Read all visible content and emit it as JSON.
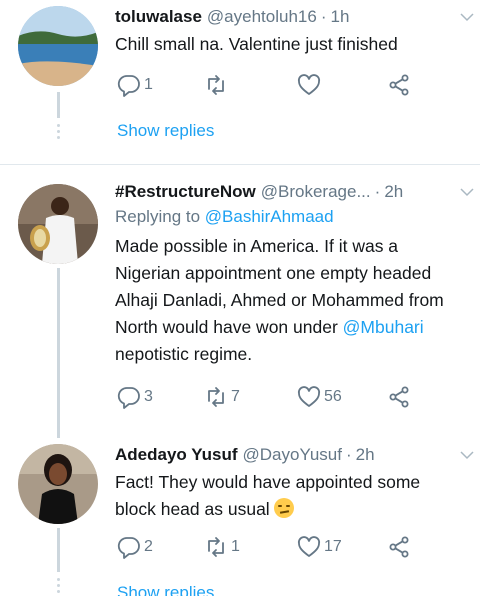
{
  "tweets": [
    {
      "name": "toluwalase",
      "handle": "@ayehtoluh16",
      "time": "1h",
      "reply_to_label": "",
      "reply_to_user": "",
      "text": "Chill small na. Valentine just finished",
      "replies": "1",
      "retweets": "",
      "likes": "",
      "show_replies": "Show replies"
    },
    {
      "name": "#RestructureNow",
      "handle": "@Brokerage...",
      "time": "2h",
      "reply_to_label": "Replying to",
      "reply_to_user": "@BashirAhmaad",
      "text_part1": "Made possible in America. If it was a Nigerian appointment one empty headed Alhaji Danladi, Ahmed or Mohammed from North would have won under",
      "mention": "@Mbuhari",
      "text_part2": "nepotistic regime.",
      "replies": "3",
      "retweets": "7",
      "likes": "56"
    },
    {
      "name": "Adedayo Yusuf",
      "handle": "@DayoYusuf",
      "time": "2h",
      "text": "Fact! They would have appointed some block head as usual",
      "emoji": "unamused-face-emoji",
      "replies": "2",
      "retweets": "1",
      "likes": "17",
      "show_replies": "Show replies"
    }
  ],
  "colors": {
    "accent": "#1da1f2",
    "secondary_text": "#657786",
    "divider": "#e1e8ed",
    "thread_line": "#ccd6dd"
  },
  "icons": [
    "reply-icon",
    "retweet-icon",
    "like-icon",
    "share-icon",
    "caret-down-icon"
  ]
}
